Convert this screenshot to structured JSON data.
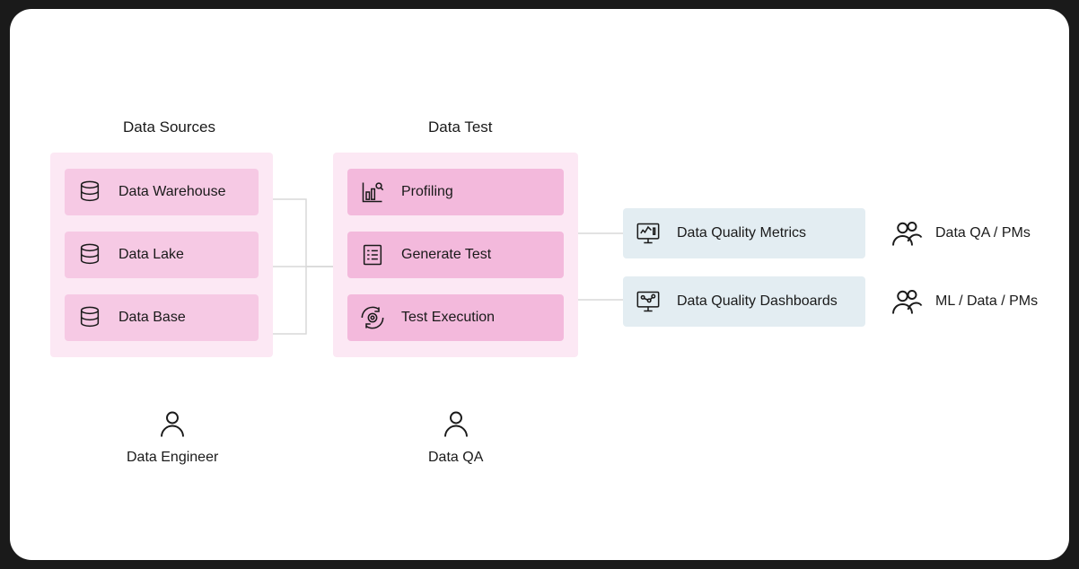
{
  "titles": {
    "sources": "Data Sources",
    "test": "Data Test"
  },
  "sources": {
    "items": [
      {
        "label": "Data Warehouse"
      },
      {
        "label": "Data Lake"
      },
      {
        "label": "Data Base"
      }
    ],
    "role": "Data Engineer"
  },
  "tests": {
    "items": [
      {
        "label": "Profiling"
      },
      {
        "label": "Generate Test"
      },
      {
        "label": "Test Execution"
      }
    ],
    "role": "Data QA"
  },
  "outputs": [
    {
      "label": "Data Quality Metrics",
      "audience": "Data QA / PMs"
    },
    {
      "label": "Data Quality Dashboards",
      "audience": "ML / Data / PMs"
    }
  ]
}
